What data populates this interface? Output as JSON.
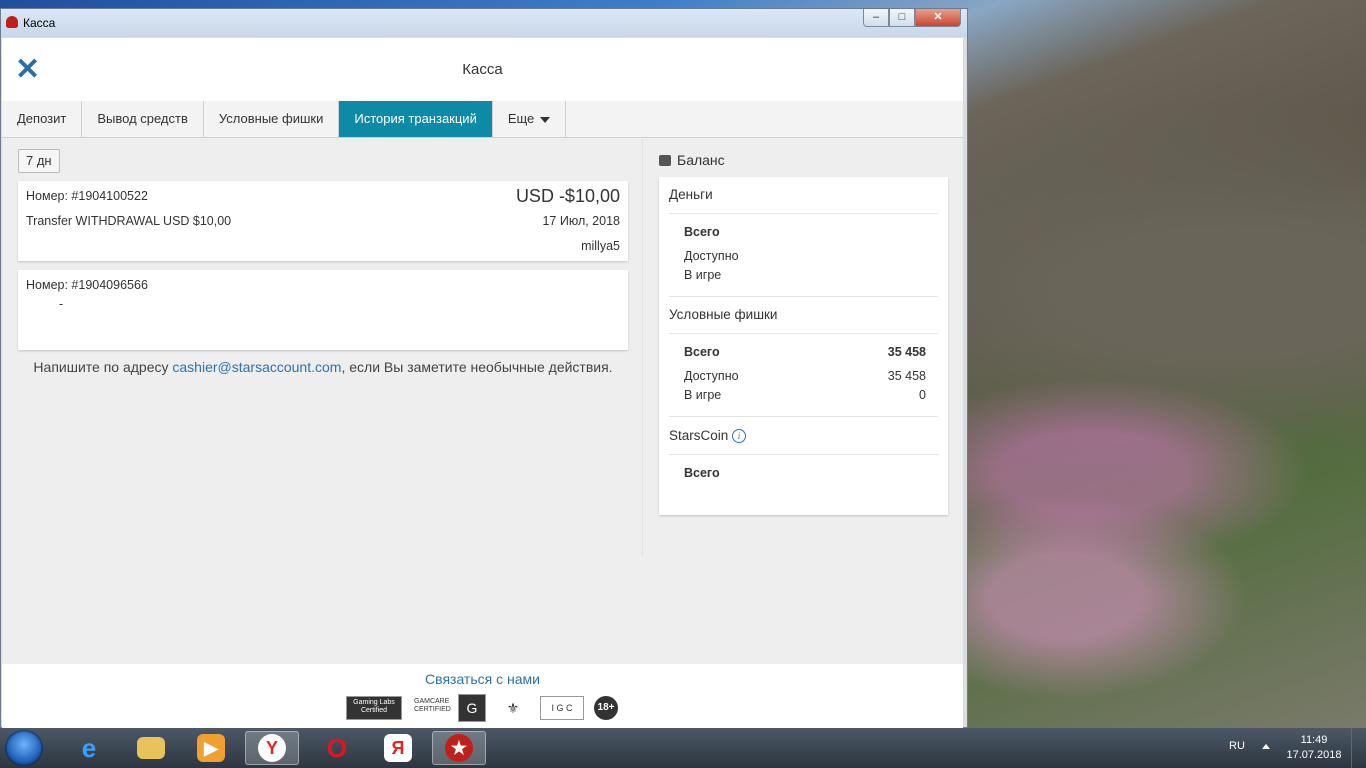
{
  "window": {
    "title": "Касса"
  },
  "header": {
    "title": "Касса"
  },
  "tabs": [
    {
      "label": "Депозит"
    },
    {
      "label": "Вывод средств"
    },
    {
      "label": "Условные фишки"
    },
    {
      "label": "История транзакций"
    },
    {
      "label": "Еще"
    }
  ],
  "filter": {
    "label": "7 дн"
  },
  "transactions": [
    {
      "number": "Номер: #1904100522",
      "amount": "USD -$10,00",
      "description": "Transfer WITHDRAWAL USD $10,00",
      "date": "17 Июл, 2018",
      "user": "millya5"
    },
    {
      "number": "Номер: #1904096566",
      "description": "-"
    }
  ],
  "note": {
    "prefix": "Напишите по адресу",
    "email": "cashier@starsaccount.com",
    "suffix": ", если Вы заметите необычные действия."
  },
  "balance": {
    "title": "Баланс",
    "money": {
      "title": "Деньги",
      "total_label": "Всего",
      "available_label": "Доступно",
      "in_play_label": "В игре"
    },
    "play_chips": {
      "title": "Условные фишки",
      "total_label": "Всего",
      "total_value": "35 458",
      "available_label": "Доступно",
      "available_value": "35 458",
      "in_play_label": "В игре",
      "in_play_value": "0"
    },
    "starscoin": {
      "title": "StarsCoin",
      "total_label": "Всего"
    }
  },
  "footer": {
    "contact": "Связаться с нами",
    "logos": [
      "Gaming Labs Certified",
      "GAMCARE CERTIFIED",
      "G GAMCARE",
      "crest",
      "IGC",
      "18+"
    ]
  },
  "taskbar": {
    "items": [
      "start",
      "internet-explorer",
      "file-explorer",
      "media-player",
      "yandex-browser",
      "opera",
      "yandex",
      "pokerstars"
    ],
    "language": "RU",
    "time": "11:49",
    "date": "17.07.2018"
  },
  "colors": {
    "accent_tab": "#0d8aa6",
    "link": "#2b72b0"
  }
}
